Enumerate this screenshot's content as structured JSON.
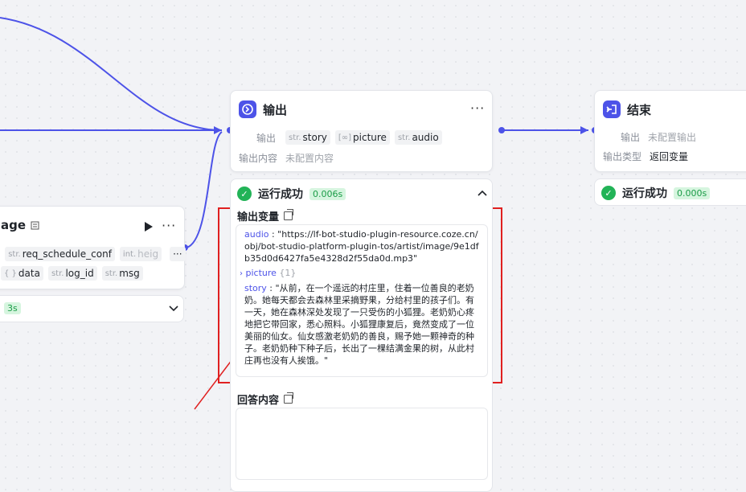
{
  "colors": {
    "accent": "#4d53e8",
    "success": "#22b357",
    "highlight": "#e02020"
  },
  "left_node": {
    "title_partial": "age",
    "outputs_row1": [
      {
        "type": "str.",
        "name": "req_schedule_conf"
      },
      {
        "type": "int.",
        "name": "heig"
      }
    ],
    "outputs_row2": [
      {
        "type": "{ }",
        "name": "data"
      },
      {
        "type": "str.",
        "name": "log_id"
      },
      {
        "type": "str.",
        "name": "msg"
      }
    ],
    "more": "···",
    "overflow": "···",
    "run_time": "3s"
  },
  "output_node": {
    "title": "输出",
    "more": "···",
    "output_label": "输出",
    "outputs": [
      {
        "type": "str.",
        "name": "story"
      },
      {
        "type": "[∞]",
        "name": "picture"
      },
      {
        "type": "str.",
        "name": "audio"
      }
    ],
    "content_label": "输出内容",
    "content_value": "未配置内容",
    "status": "运行成功",
    "time": "0.006s",
    "var_title": "输出变量",
    "audio_key": "audio",
    "audio_value": " : \"https://lf-bot-studio-plugin-resource.coze.cn/obj/bot-studio-platform-plugin-tos/artist/image/9e1dfb35d0d6427fa5e4328d2f55da0d.mp3\"",
    "picture_key": "picture",
    "picture_count": "{1}",
    "story_key": "story",
    "story_value": " : \"从前，在一个遥远的村庄里，住着一位善良的老奶奶。她每天都会去森林里采摘野果，分给村里的孩子们。有一天，她在森林深处发现了一只受伤的小狐狸。老奶奶心疼地把它带回家，悉心照料。小狐狸康复后，竟然变成了一位美丽的仙女。仙女感激老奶奶的善良，赐予她一颗神奇的种子。老奶奶种下种子后，长出了一棵结满金果的树，从此村庄再也没有人挨饿。\"",
    "answer_title": "回答内容"
  },
  "end_node": {
    "title": "结束",
    "output_label": "输出",
    "output_value": "未配置输出",
    "type_label": "输出类型",
    "type_value": "返回变量",
    "status": "运行成功",
    "time": "0.000s"
  }
}
